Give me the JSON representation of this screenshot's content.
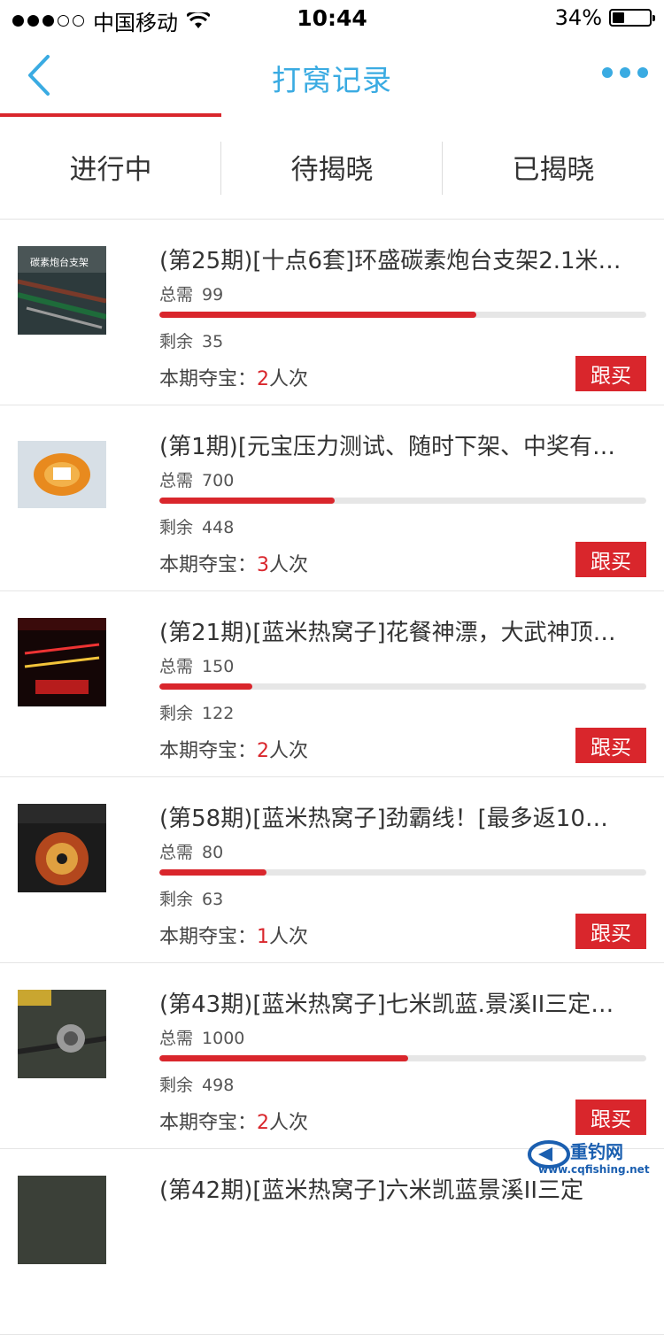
{
  "status_bar": {
    "carrier": "中国移动",
    "time": "10:44",
    "battery": "34%"
  },
  "nav": {
    "title": "打窝记录",
    "back_icon": "chevron-left-icon",
    "more_icon": "more-dots-icon"
  },
  "tabs": [
    {
      "label": "进行中",
      "active": true
    },
    {
      "label": "待揭晓",
      "active": false
    },
    {
      "label": "已揭晓",
      "active": false
    }
  ],
  "labels": {
    "total": "总需",
    "remain": "剩余",
    "bought_prefix": "本期夺宝：",
    "bought_suffix": "人次",
    "button": "跟买"
  },
  "items": [
    {
      "title": "(第25期)[十点6套]环盛碳素炮台支架2.1米…",
      "total": "99",
      "remain": "35",
      "bought": "2",
      "progress": 0.65
    },
    {
      "title": "(第1期)[元宝压力测试、随时下架、中奖有…",
      "total": "700",
      "remain": "448",
      "bought": "3",
      "progress": 0.36
    },
    {
      "title": "(第21期)[蓝米热窝子]花餐神漂，大武神顶…",
      "total": "150",
      "remain": "122",
      "bought": "2",
      "progress": 0.19
    },
    {
      "title": "(第58期)[蓝米热窝子]劲霸线！[最多返10…",
      "total": "80",
      "remain": "63",
      "bought": "1",
      "progress": 0.22
    },
    {
      "title": "(第43期)[蓝米热窝子]七米凯蓝.景溪II三定…",
      "total": "1000",
      "remain": "498",
      "bought": "2",
      "progress": 0.51
    },
    {
      "title": "(第42期)[蓝米热窝子]六米凯蓝景溪II三定",
      "total": "",
      "remain": "",
      "bought": "",
      "progress": 0
    }
  ],
  "watermark": {
    "text": "重钓网",
    "url": "www.cqfishing.net"
  },
  "colors": {
    "accent_blue": "#3aabe2",
    "accent_red": "#d9262c"
  }
}
